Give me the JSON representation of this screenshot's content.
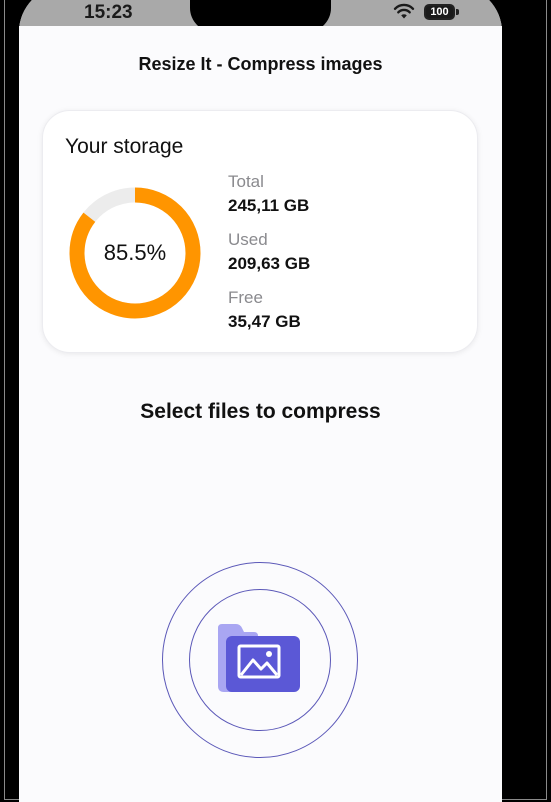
{
  "status_bar": {
    "time": "15:23",
    "battery": "100"
  },
  "header": {
    "title": "Resize It - Compress images"
  },
  "storage": {
    "title": "Your storage",
    "used_percent_text": "85.5%",
    "used_fraction": 0.855,
    "ring_color": "#ff9500",
    "track_color": "#ececec",
    "stats": [
      {
        "label": "Total",
        "value": "245,11 GB"
      },
      {
        "label": "Used",
        "value": "209,63 GB"
      },
      {
        "label": "Free",
        "value": "35,47 GB"
      }
    ]
  },
  "select_section": {
    "title": "Select files to compress"
  },
  "colors": {
    "accent": "#5b58d6",
    "accent_light": "#a9a6f2"
  }
}
